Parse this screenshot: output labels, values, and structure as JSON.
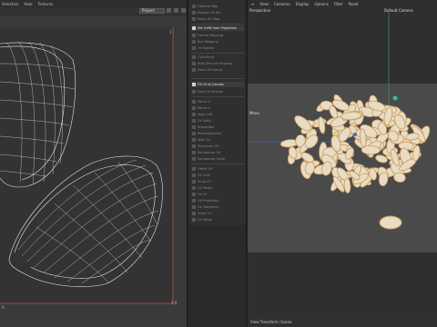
{
  "uv_editor": {
    "menu": [
      "Selection",
      "Heal",
      "Textures"
    ],
    "projection_select": "Project",
    "tick_top_right": "1",
    "tick_origin": "0",
    "tick_bottom_right": "1,0"
  },
  "command_panel": {
    "items": [
      {
        "label": "Optimal Map",
        "active": false
      },
      {
        "label": "Realign UV Rel",
        "active": false
      },
      {
        "label": "Relax UV Map",
        "active": false
      },
      {
        "label": "Set UVW from Projection",
        "active": true
      },
      {
        "label": "Frontal Mapping",
        "active": false
      },
      {
        "label": "Box Mapping",
        "active": false
      },
      {
        "label": "UV Islands",
        "active": false
      },
      {
        "label": "Cylindrical",
        "active": false
      },
      {
        "label": "Multi-Texture Mapping",
        "active": false
      },
      {
        "label": "Pack UV Islands",
        "active": false
      },
      {
        "label": "Fit UV to Canvas",
        "active": true
      },
      {
        "label": "Pack UV Bounds",
        "active": false
      },
      {
        "label": "Mirror U",
        "active": false
      },
      {
        "label": "Mirror V",
        "active": false
      },
      {
        "label": "Align Left",
        "active": false
      },
      {
        "label": "UV Weld",
        "active": false
      },
      {
        "label": "Straighten",
        "active": false
      },
      {
        "label": "Rectangularize",
        "active": false
      },
      {
        "label": "Split UV",
        "active": false
      },
      {
        "label": "Transform UV",
        "active": false
      },
      {
        "label": "Randomize UV",
        "active": false
      },
      {
        "label": "Randomize Scale",
        "active": false
      },
      {
        "label": "Offset UV",
        "active": false
      },
      {
        "label": "UV Grid",
        "active": false
      },
      {
        "label": "Snap UV",
        "active": false
      },
      {
        "label": "UV Peeler",
        "active": false
      },
      {
        "label": "Fit UV",
        "active": false
      },
      {
        "label": "UV Projection",
        "active": false
      },
      {
        "label": "UV Transform",
        "active": false
      },
      {
        "label": "Scale UV",
        "active": false
      },
      {
        "label": "UV Relax",
        "active": false
      }
    ]
  },
  "viewport": {
    "menu": [
      "View",
      "Cameras",
      "Display",
      "Options",
      "Filter",
      "Panel"
    ],
    "projection": "Perspective",
    "camera": "Default Camera",
    "layer": "Move",
    "status": "View Transform: Scene"
  },
  "colors": {
    "seed_fill": "#e8dcc4",
    "seed_edge": "#c89a5a",
    "uv_lines": "#e8e8e8",
    "axis_green": "#3aa86a",
    "axis_blue": "#3a6ad8",
    "uv_border_red": "#c84a4a"
  }
}
